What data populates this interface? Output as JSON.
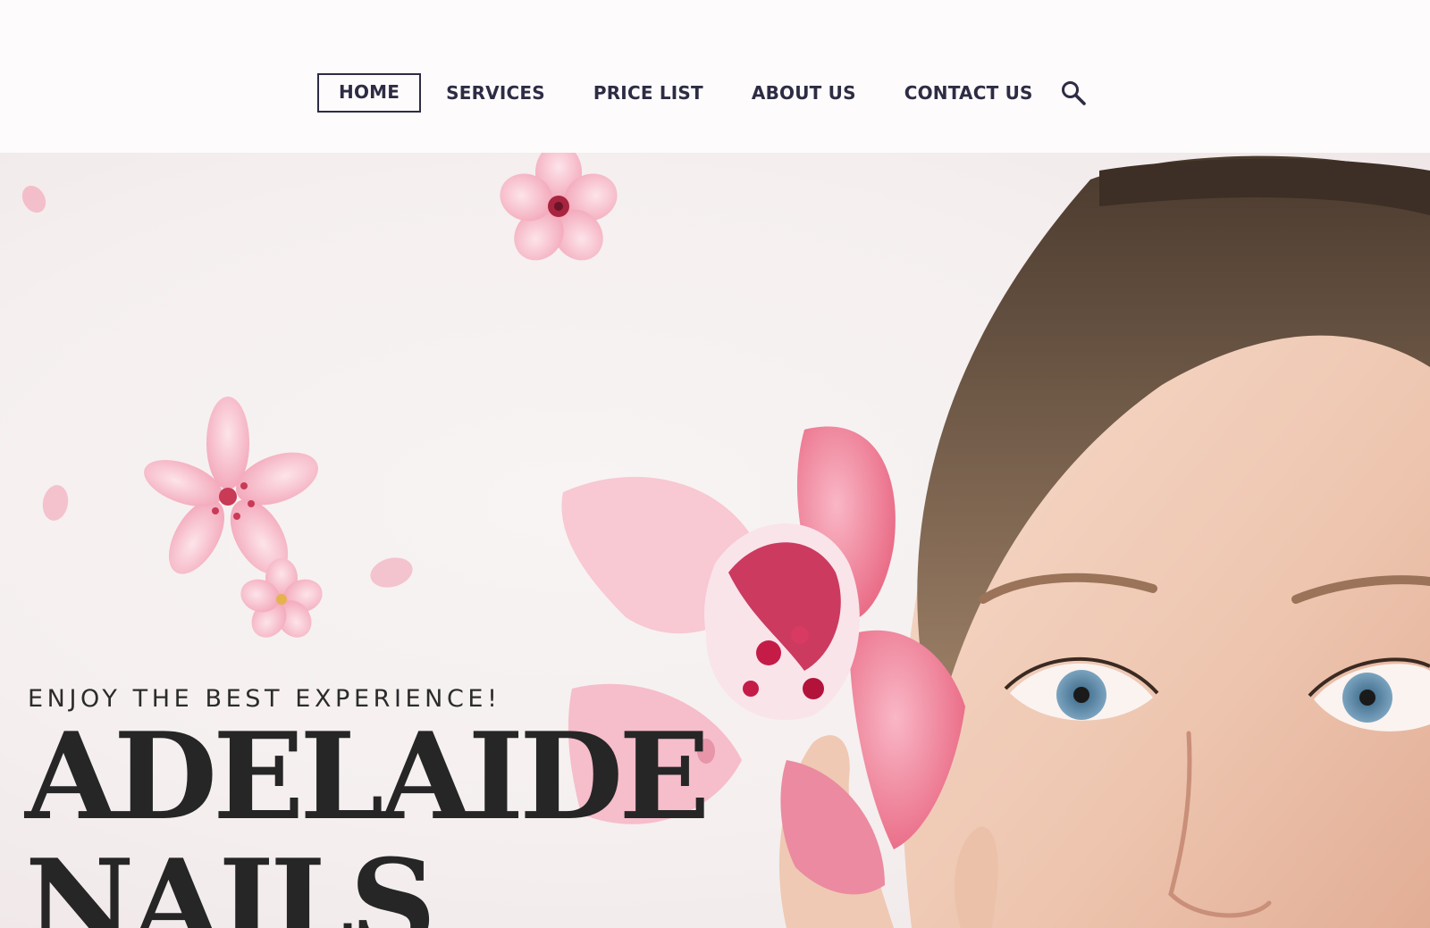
{
  "nav": {
    "items": [
      {
        "label": "HOME",
        "active": true
      },
      {
        "label": "SERVICES",
        "active": false
      },
      {
        "label": "PRICE LIST",
        "active": false
      },
      {
        "label": "ABOUT US",
        "active": false
      },
      {
        "label": "CONTACT US",
        "active": false
      }
    ],
    "search_icon": "search-icon"
  },
  "hero": {
    "tagline": "ENJOY THE BEST EXPERIENCE!",
    "title_line1": "ADELAIDE",
    "title_line2": "NAILS"
  },
  "colors": {
    "nav_text": "#2d2c44",
    "title_text": "#262626",
    "background": "#fdfbfb",
    "accent_pink": "#f2849e"
  }
}
